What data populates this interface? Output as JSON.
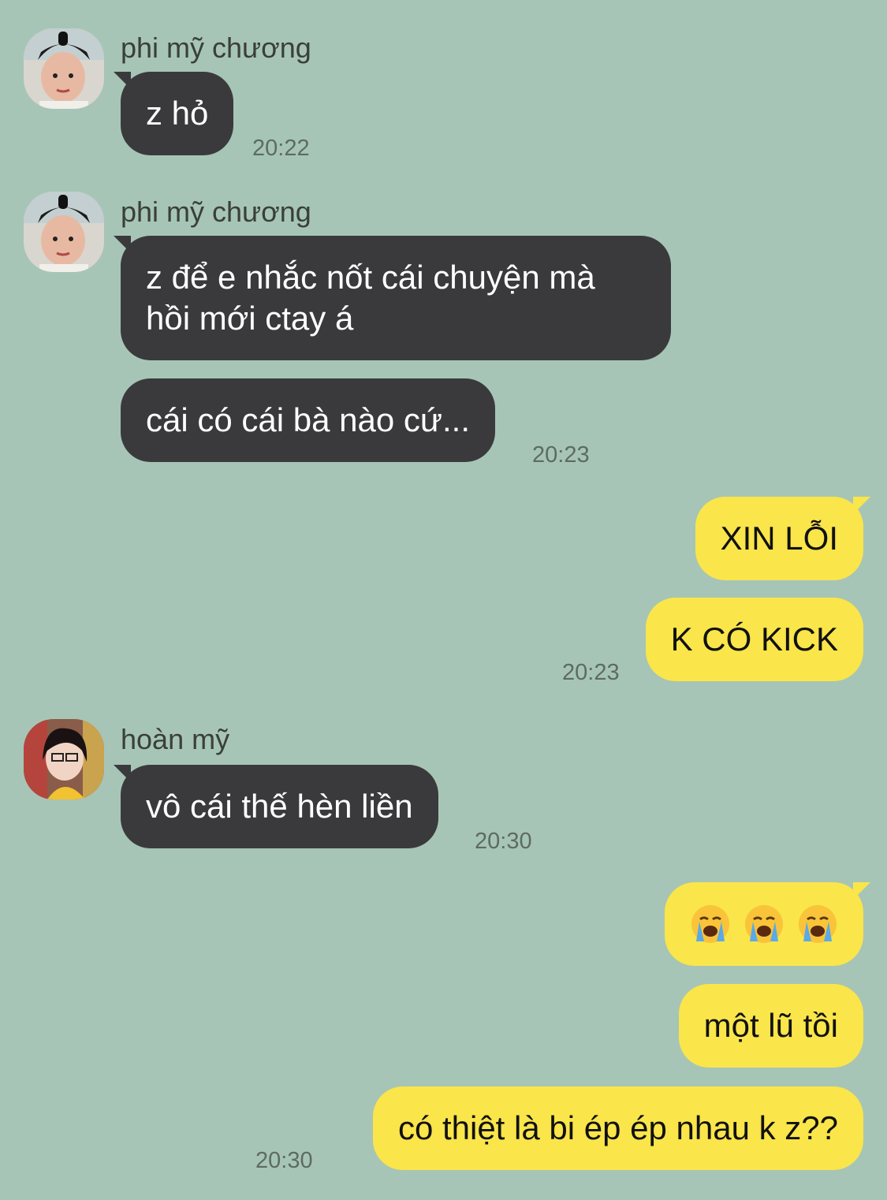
{
  "messages": [
    {
      "sender": "phi mỹ chương",
      "text": "z hỏ",
      "time": "20:22"
    },
    {
      "sender": "phi mỹ chương",
      "text": "z để e nhắc nốt cái chuyện mà hồi mới ctay á"
    },
    {
      "text": "cái có cái bà nào cứ...",
      "time": "20:23"
    },
    {
      "text": "XIN LỖI"
    },
    {
      "text": "K CÓ KICK",
      "time": "20:23"
    },
    {
      "sender": "hoàn mỹ",
      "text": "vô cái thế hèn liền",
      "time": "20:30"
    },
    {
      "emoji": [
        "loudly-crying-face",
        "loudly-crying-face",
        "loudly-crying-face"
      ]
    },
    {
      "text": "một lũ tồi"
    },
    {
      "text": "có thiệt là bi ép ép nhau k z??",
      "time": "20:30"
    }
  ],
  "colors": {
    "background": "#a7c5b6",
    "incoming_bubble": "#3a3a3c",
    "outgoing_bubble": "#fae54a"
  }
}
